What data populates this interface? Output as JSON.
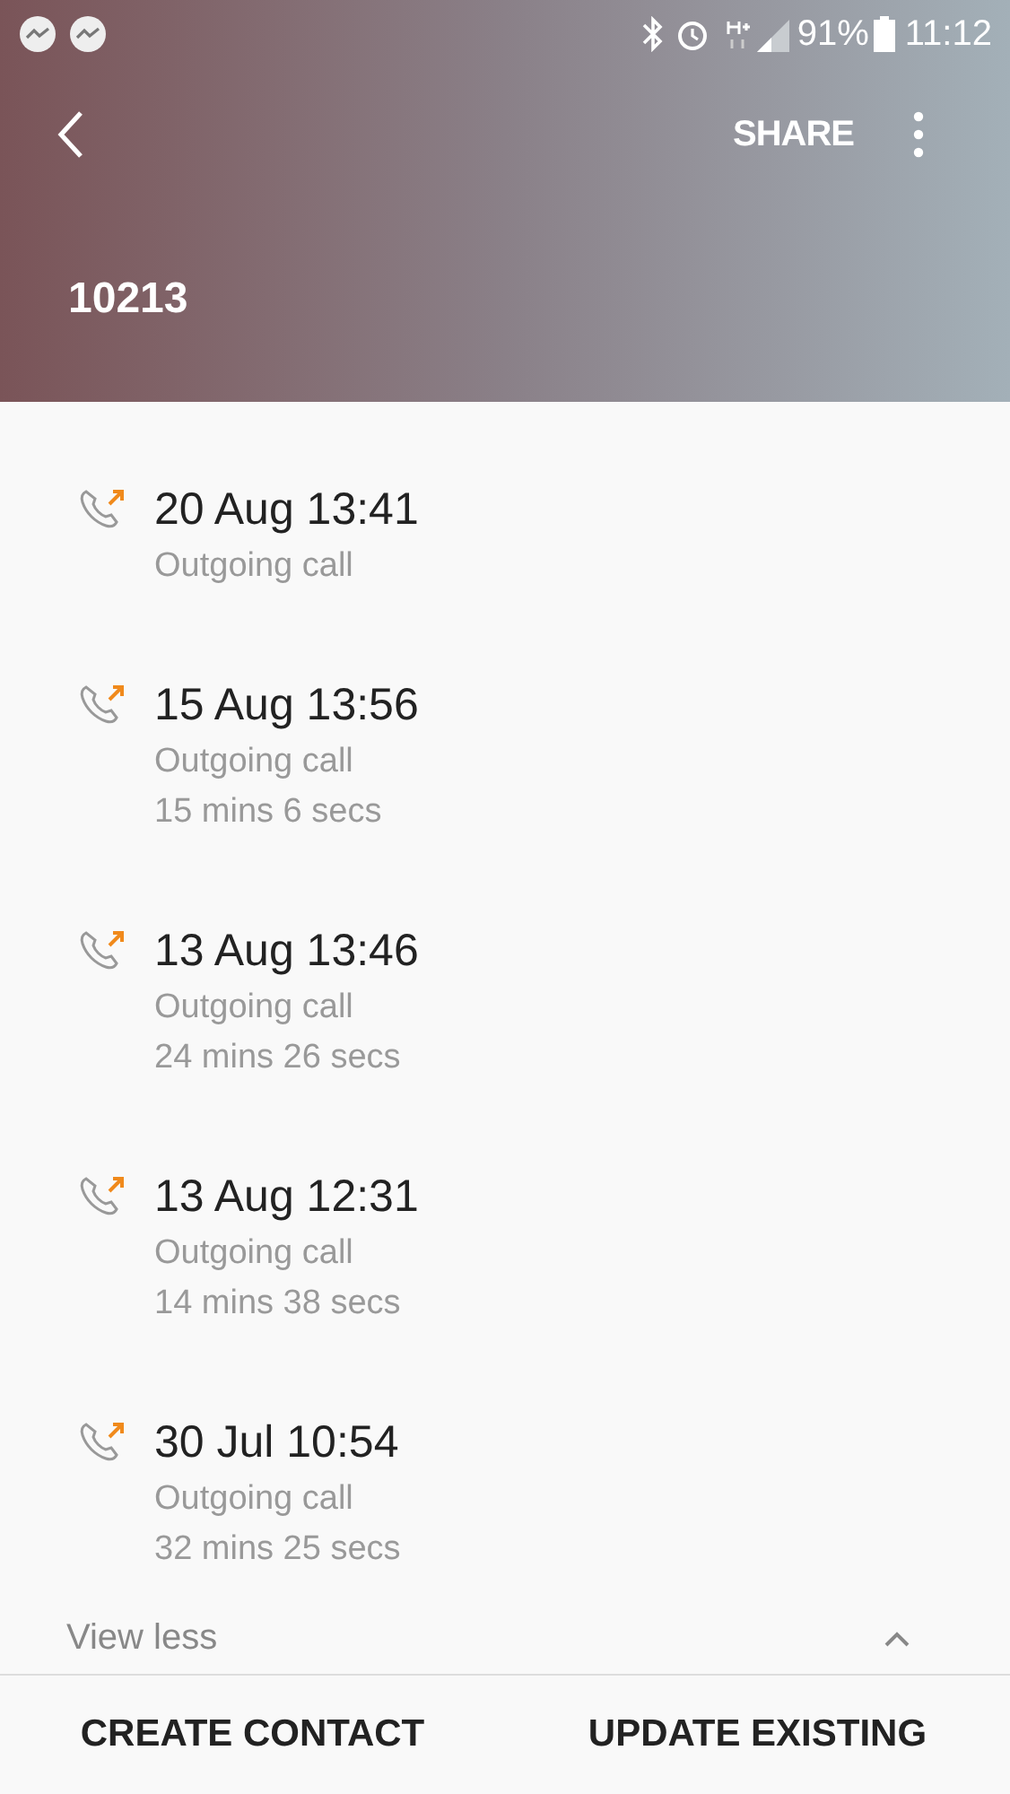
{
  "status_bar": {
    "battery": "91%",
    "time": "11:12"
  },
  "toolbar": {
    "action": "SHARE"
  },
  "title": "10213",
  "calls": [
    {
      "datetime": "20 Aug 13:41",
      "type": "Outgoing call"
    },
    {
      "datetime": "15 Aug 13:56",
      "type": "Outgoing call",
      "duration": "15 mins 6 secs"
    },
    {
      "datetime": "13 Aug 13:46",
      "type": "Outgoing call",
      "duration": "24 mins 26 secs"
    },
    {
      "datetime": "13 Aug 12:31",
      "type": "Outgoing call",
      "duration": "14 mins 38 secs"
    },
    {
      "datetime": "30 Jul 10:54",
      "type": "Outgoing call",
      "duration": "32 mins 25 secs"
    }
  ],
  "toggle": "View less",
  "buttons": [
    "CREATE CONTACT",
    "UPDATE EXISTING"
  ]
}
